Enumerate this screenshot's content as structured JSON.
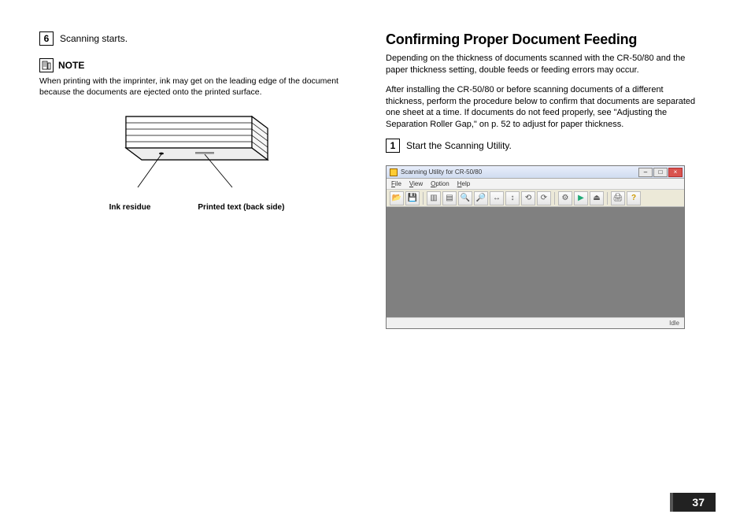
{
  "left": {
    "step_num": "6",
    "step_text": "Scanning starts.",
    "note_label": "NOTE",
    "note_text": "When printing with the imprinter, ink may get on the leading edge of the document because the documents are ejected onto the printed surface.",
    "callout1": "Ink residue",
    "callout2": "Printed text (back side)"
  },
  "right": {
    "heading": "Confirming Proper Document Feeding",
    "para1": "Depending on the thickness of documents scanned with the CR-50/80 and the paper thickness setting, double feeds or feeding errors may occur.",
    "para2": "After installing the CR-50/80 or before scanning documents of a different thickness, perform the procedure below to confirm that documents are separated one sheet at a time. If documents do not feed properly, see \"Adjusting the Separation Roller Gap,\" on p. 52 to adjust for paper thickness.",
    "step_num": "1",
    "step_text": "Start the Scanning Utility.",
    "app": {
      "title": "Scanning Utility for CR-50/80",
      "menus": {
        "file": "File",
        "view": "View",
        "option": "Option",
        "help": "Help"
      },
      "status": "Idle"
    }
  },
  "page_number": "37"
}
